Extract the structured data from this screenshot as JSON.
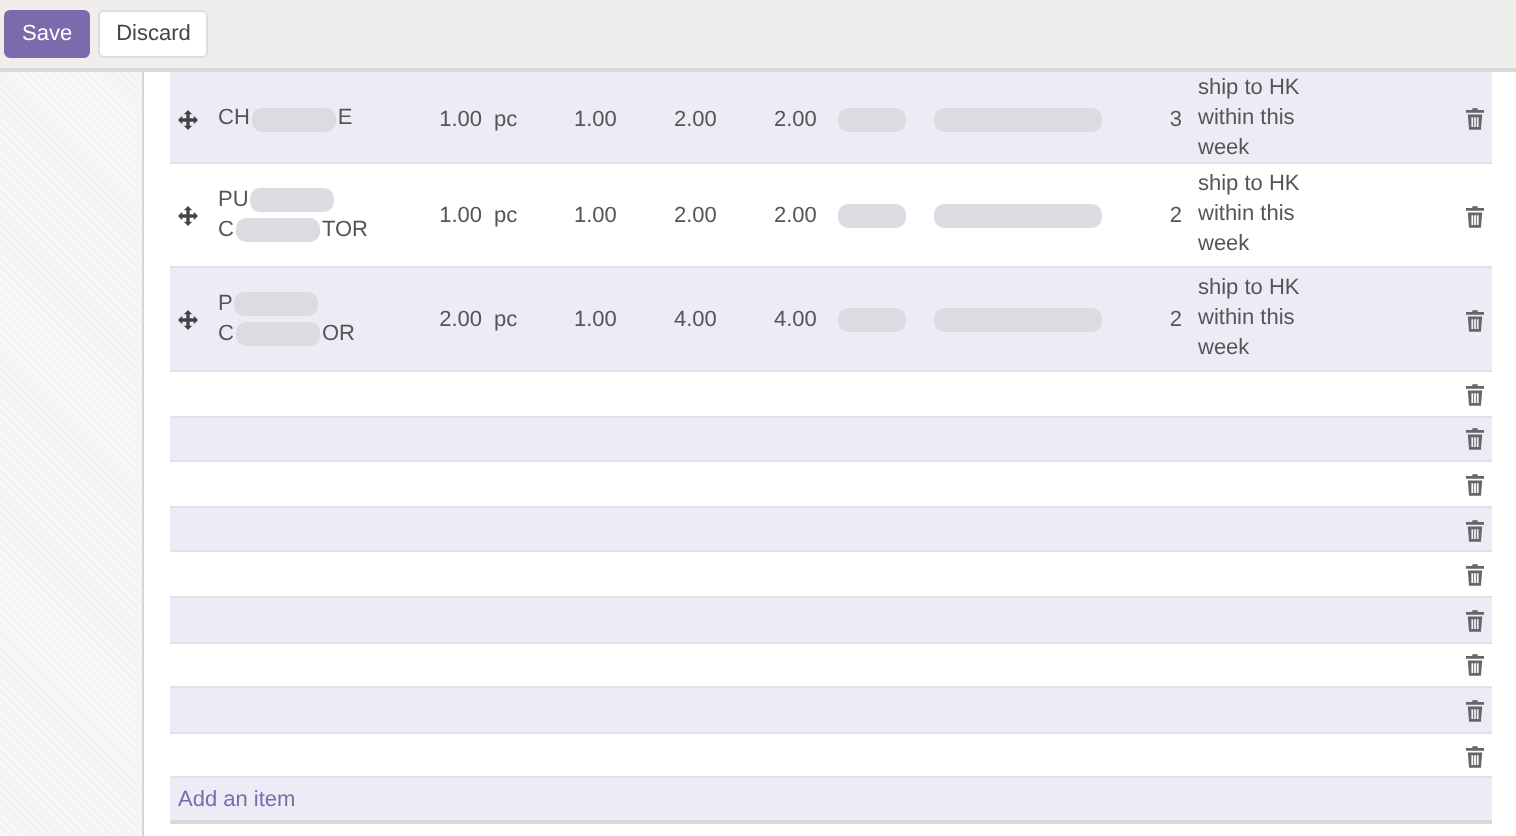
{
  "toolbar": {
    "buttons": [
      {
        "label": "Save",
        "kind": "primary"
      },
      {
        "label": "Discard",
        "kind": "secondary"
      }
    ]
  },
  "lines": [
    {
      "product": [
        {
          "before": "CH",
          "after": "E"
        }
      ],
      "quantity": "1.00",
      "uom": "pc",
      "col_price": "1.00",
      "col_subtotal": "2.00",
      "col_total": "2.00",
      "count": "3",
      "note": [
        "ship to HK",
        "within this",
        "week"
      ]
    },
    {
      "product": [
        {
          "before": "PU"
        },
        {
          "before": "C",
          "after": "TOR"
        }
      ],
      "quantity": "1.00",
      "uom": "pc",
      "col_price": "1.00",
      "col_subtotal": "2.00",
      "col_total": "2.00",
      "count": "2",
      "note": [
        "ship to HK",
        "within this",
        "week"
      ]
    },
    {
      "product": [
        {
          "before": "P"
        },
        {
          "before": "C",
          "after": "OR"
        }
      ],
      "quantity": "2.00",
      "uom": "pc",
      "col_price": "1.00",
      "col_subtotal": "4.00",
      "col_total": "4.00",
      "count": "2",
      "note": [
        "ship to HK",
        "within this",
        "week"
      ]
    }
  ],
  "add_item": "Add an item"
}
